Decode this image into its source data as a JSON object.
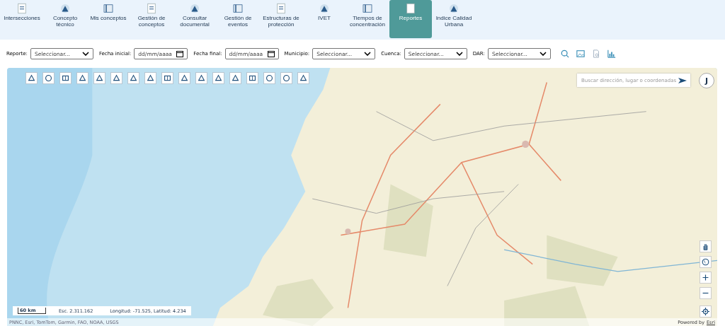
{
  "nav": [
    {
      "label": "Intersecciones",
      "selected": false
    },
    {
      "label": "Concepto técnico",
      "selected": false
    },
    {
      "label": "Mis conceptos",
      "selected": false
    },
    {
      "label": "Gestión de conceptos",
      "selected": false
    },
    {
      "label": "Consultar documental",
      "selected": false
    },
    {
      "label": "Gestión de eventos",
      "selected": false
    },
    {
      "label": "Estructuras de protección",
      "selected": false
    },
    {
      "label": "IVET",
      "selected": false
    },
    {
      "label": "Tiempos de concentración",
      "selected": false
    },
    {
      "label": "Reportes",
      "selected": true
    },
    {
      "label": "Indice Calidad Urbana",
      "selected": false
    }
  ],
  "filters": [
    {
      "label": "Reporte:",
      "kind": "select",
      "value": "Seleccionar..."
    },
    {
      "label": "Fecha inicial:",
      "kind": "date",
      "value": "dd/mm/aaaa"
    },
    {
      "label": "Fecha final:",
      "kind": "date",
      "value": "dd/mm/aaaa"
    },
    {
      "label": "Municipio:",
      "kind": "select",
      "value": "Seleccionar..."
    },
    {
      "label": "Cuenca:",
      "kind": "select",
      "value": "Seleccionar..."
    },
    {
      "label": "DAR:",
      "kind": "select",
      "value": "Seleccionar..."
    }
  ],
  "map": {
    "search": {
      "placeholder": "Buscar dirección, lugar o coordenadas"
    },
    "user_initial": "J",
    "scale": "60 km",
    "scale_ratio": "Esc. 2.311.162",
    "coordinates": "Longitud: -71.525, Latitud: 4.234",
    "attribution": "PNNC, Esri, TomTom, Garmin, FAO, NOAA, USGS",
    "powered_by": "Powered by",
    "powered_link": "Esri"
  }
}
